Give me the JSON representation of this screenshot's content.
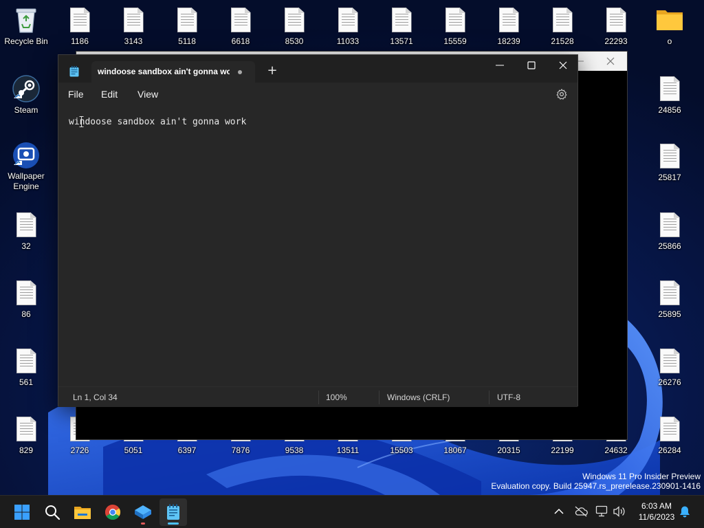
{
  "desktop": {
    "top_row": [
      {
        "label": "Recycle Bin",
        "icon": "recycle-bin-icon"
      },
      {
        "label": "1186"
      },
      {
        "label": "3143"
      },
      {
        "label": "5118"
      },
      {
        "label": "6618"
      },
      {
        "label": "8530"
      },
      {
        "label": "11033"
      },
      {
        "label": "13571"
      },
      {
        "label": "15559"
      },
      {
        "label": "18239"
      },
      {
        "label": "21528"
      },
      {
        "label": "22293"
      },
      {
        "label": "o",
        "icon": "folder-icon"
      }
    ],
    "left_column": [
      {
        "label": "Steam",
        "icon": "steam-icon"
      },
      {
        "label": "Wallpaper Engine",
        "icon": "wallpaper-engine-icon"
      },
      {
        "label": "32"
      },
      {
        "label": "86"
      },
      {
        "label": "561"
      },
      {
        "label": "829"
      }
    ],
    "right_column": [
      {
        "label": "24856"
      },
      {
        "label": "25817"
      },
      {
        "label": "25866"
      },
      {
        "label": "25895"
      },
      {
        "label": "26276"
      },
      {
        "label": "26284"
      }
    ],
    "bottom_row": [
      {
        "label": "2726"
      },
      {
        "label": "5051"
      },
      {
        "label": "6397"
      },
      {
        "label": "7876"
      },
      {
        "label": "9538"
      },
      {
        "label": "13511"
      },
      {
        "label": "15503"
      },
      {
        "label": "18067"
      },
      {
        "label": "20315"
      },
      {
        "label": "22199"
      },
      {
        "label": "24632"
      }
    ]
  },
  "notepad": {
    "tab_title": "windoose sandbox ain't gonna wor",
    "menu": {
      "file": "File",
      "edit": "Edit",
      "view": "View"
    },
    "content": "windoose sandbox ain't gonna work",
    "status": {
      "position": "Ln 1, Col 34",
      "zoom": "100%",
      "line_ending": "Windows (CRLF)",
      "encoding": "UTF-8"
    }
  },
  "watermark": {
    "line1": "Windows 11 Pro Insider Preview",
    "line2": "Evaluation copy. Build 25947.rs_prerelease.230901-1416"
  },
  "taskbar": {
    "apps": [
      "start-icon",
      "search-icon",
      "file-explorer-icon",
      "chrome-icon",
      "sandbox-icon",
      "notepad-icon"
    ],
    "clock": {
      "time": "6:03 AM",
      "date": "11/6/2023"
    }
  },
  "colors": {
    "accent": "#0078d4",
    "notepad_bg": "#272727",
    "titlebar_bg": "#202020",
    "taskbar_bg": "#1c1c1c",
    "wallpaper_blue": "#1f5fe0"
  }
}
